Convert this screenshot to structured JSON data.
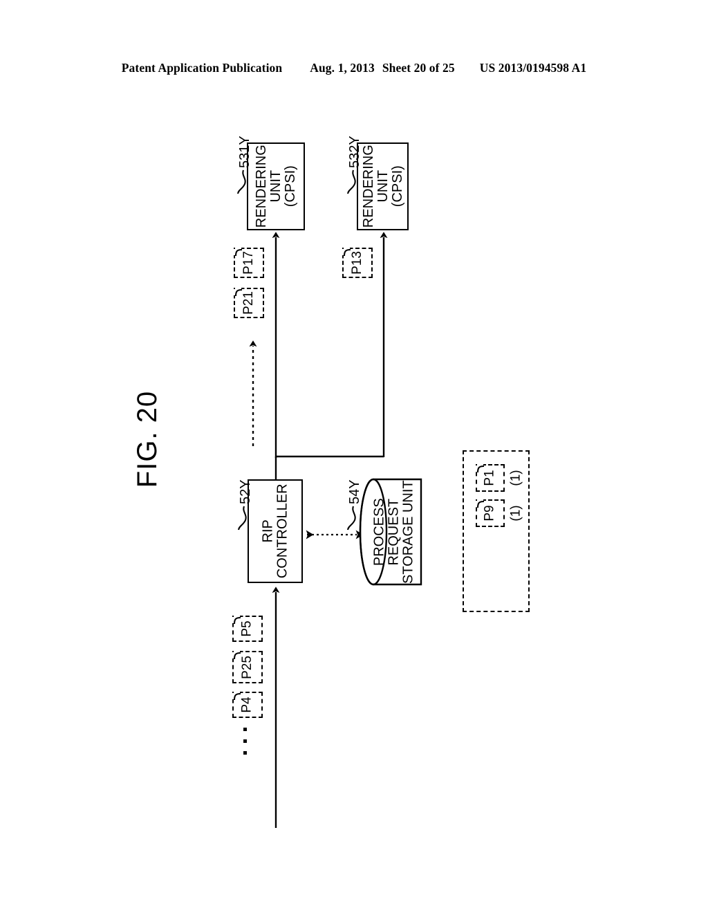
{
  "header": {
    "publication": "Patent Application Publication",
    "date": "Aug. 1, 2013",
    "sheet": "Sheet 20 of 25",
    "docnum": "US 2013/0194598 A1"
  },
  "figure": {
    "title": "FIG. 20",
    "blocks": [
      {
        "id": "rendering-unit-1",
        "ref": "531Y",
        "line1": "RENDERING",
        "line2": "UNIT",
        "line3": "(CPSI)"
      },
      {
        "id": "rendering-unit-2",
        "ref": "532Y",
        "line1": "RENDERING",
        "line2": "UNIT",
        "line3": "(CPSI)"
      },
      {
        "id": "rip-controller",
        "ref": "52Y",
        "line1": "RIP",
        "line2": "CONTROLLER",
        "line3": ""
      },
      {
        "id": "process-request-storage",
        "ref": "54Y",
        "line1": "PROCESS",
        "line2": "REQUEST",
        "line3": "STORAGE UNIT"
      }
    ],
    "packets": {
      "to_rendering_unit_1": [
        "P17",
        "P21"
      ],
      "to_rendering_unit_2": [
        "P13"
      ],
      "input_queue": [
        "P5",
        "P25",
        "P4"
      ],
      "input_queue_more": "⋮",
      "stored": [
        {
          "name": "P1",
          "count": "(1)"
        },
        {
          "name": "P9",
          "count": "(1)"
        }
      ]
    }
  }
}
